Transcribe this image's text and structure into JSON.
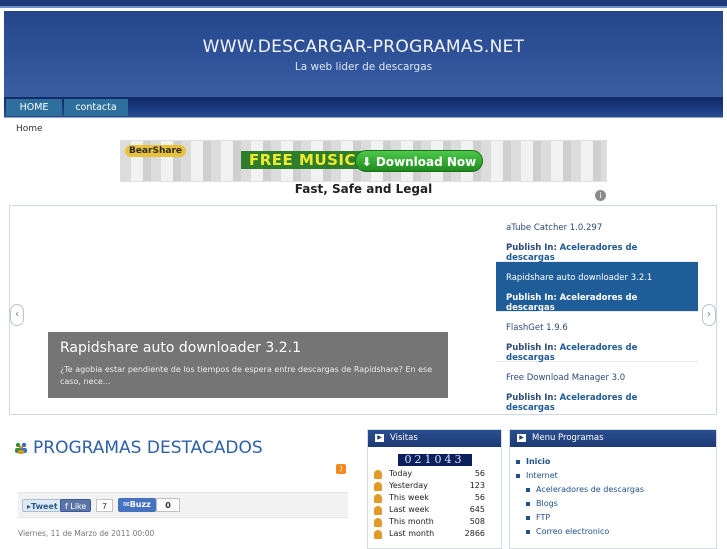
{
  "header": {
    "site_title": "WWW.DESCARGAR-PROGRAMAS.NET",
    "tagline": "La web lider de descargas"
  },
  "nav": {
    "items": [
      {
        "label": "HOME"
      },
      {
        "label": "contacta"
      }
    ]
  },
  "breadcrumb": {
    "label": "Home"
  },
  "banner": {
    "logo_text": "BearShare",
    "free_text": "FREE MUSIC",
    "button_label": "Download Now",
    "tagline": "Fast, Safe and Legal"
  },
  "slider": {
    "caption_title": "Rapidshare auto downloader 3.2.1",
    "caption_text": "¿Te agobia estar pendiente de los tiempos de espera entre descargas de Rapidshare? En ese caso, nece...",
    "publish_label": "Publish In:",
    "items": [
      {
        "title": "aTube Catcher 1.0.297",
        "category": "Aceleradores de descargas"
      },
      {
        "title": "Rapidshare auto downloader 3.2.1",
        "category": "Aceleradores de descargas"
      },
      {
        "title": "FlashGet 1.9.6",
        "category": "Aceleradores de descargas"
      },
      {
        "title": "Free Download Manager 3.0",
        "category": "Aceleradores de descargas"
      }
    ]
  },
  "featured": {
    "title": "PROGRAMAS DESTACADOS",
    "tweet_label": "Tweet",
    "like_label": "Like",
    "like_count": "7",
    "buzz_label": "Buzz",
    "buzz_count": "0",
    "date": "Viernes, 11 de Marzo de 2011 00:00"
  },
  "visitas": {
    "title": "Visitas",
    "counter": "021043",
    "rows": [
      {
        "label": "Today",
        "value": "56"
      },
      {
        "label": "Yesterday",
        "value": "123"
      },
      {
        "label": "This week",
        "value": "56"
      },
      {
        "label": "Last week",
        "value": "645"
      },
      {
        "label": "This month",
        "value": "508"
      },
      {
        "label": "Last month",
        "value": "2866"
      }
    ]
  },
  "menu": {
    "title": "Menu Programas",
    "items": [
      {
        "label": "Inicio"
      },
      {
        "label": "Internet"
      },
      {
        "label": "Aceleradores de descargas"
      },
      {
        "label": "Blogs"
      },
      {
        "label": "FTP"
      },
      {
        "label": "Correo electronico"
      }
    ]
  },
  "colors": {
    "header_blue": "#2e5198",
    "nav_blue": "#1b3c80",
    "accent_link": "#2d5fa5",
    "active_slide": "#1f5d98"
  }
}
